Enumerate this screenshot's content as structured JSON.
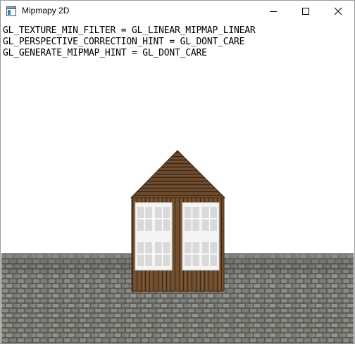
{
  "window": {
    "title": "Mipmapy 2D",
    "icon": "app-window-icon",
    "controls": [
      "minimize-icon",
      "maximize-icon",
      "close-icon"
    ]
  },
  "overlay": {
    "lines": [
      "GL_TEXTURE_MIN_FILTER = GL_LINEAR_MIPMAP_LINEAR",
      "GL_PERSPECTIVE_CORRECTION_HINT = GL_DONT_CARE",
      "GL_GENERATE_MIPMAP_HINT = GL_DONT_CARE"
    ]
  },
  "colors": {
    "background": "#ffffff",
    "wood": "#6b4a2c",
    "roof": "#5a3d22",
    "cobblestone": "#6e6e6a",
    "window_frame": "#f2f2f2"
  }
}
